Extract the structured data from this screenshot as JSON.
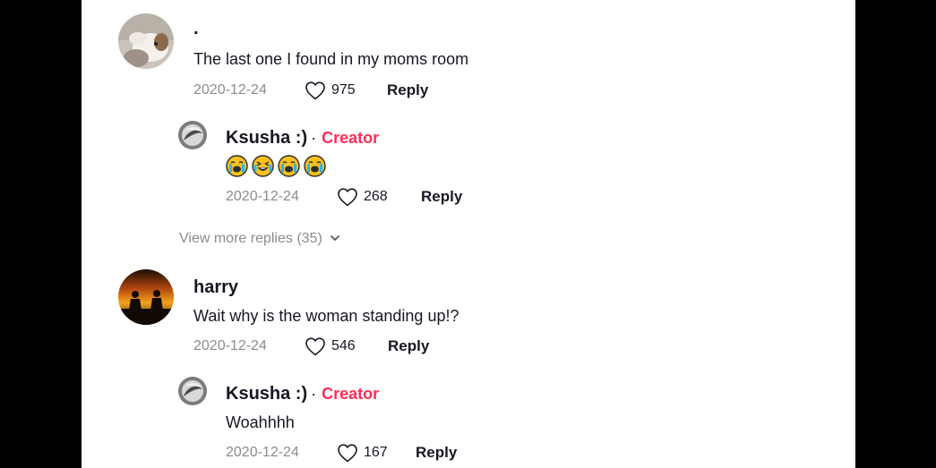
{
  "comments": [
    {
      "username": ".",
      "text": "The last one I found in my moms room",
      "date": "2020-12-24",
      "likes": "975",
      "reply_label": "Reply",
      "avatar": "dog-photo-avatar",
      "replies": [
        {
          "username": "Ksusha :)",
          "separator": "·",
          "badge": "Creator",
          "emoji_text": [
            "loudly-crying-face",
            "grinning-squinting-face-with-tears",
            "loudly-crying-face",
            "loudly-crying-face"
          ],
          "date": "2020-12-24",
          "likes": "268",
          "reply_label": "Reply"
        }
      ],
      "view_more": "View more replies (35)"
    },
    {
      "username": "harry",
      "text": "Wait why is the woman standing up!?",
      "date": "2020-12-24",
      "likes": "546",
      "reply_label": "Reply",
      "avatar": "sunset-silhouette-avatar",
      "replies": [
        {
          "username": "Ksusha :)",
          "separator": "·",
          "badge": "Creator",
          "text": "Woahhhh",
          "date": "2020-12-24",
          "likes": "167",
          "reply_label": "Reply"
        }
      ]
    }
  ],
  "colors": {
    "accent": "#fe2c55",
    "text": "#161823",
    "muted": "#8a8b91",
    "frame": "#000000"
  }
}
